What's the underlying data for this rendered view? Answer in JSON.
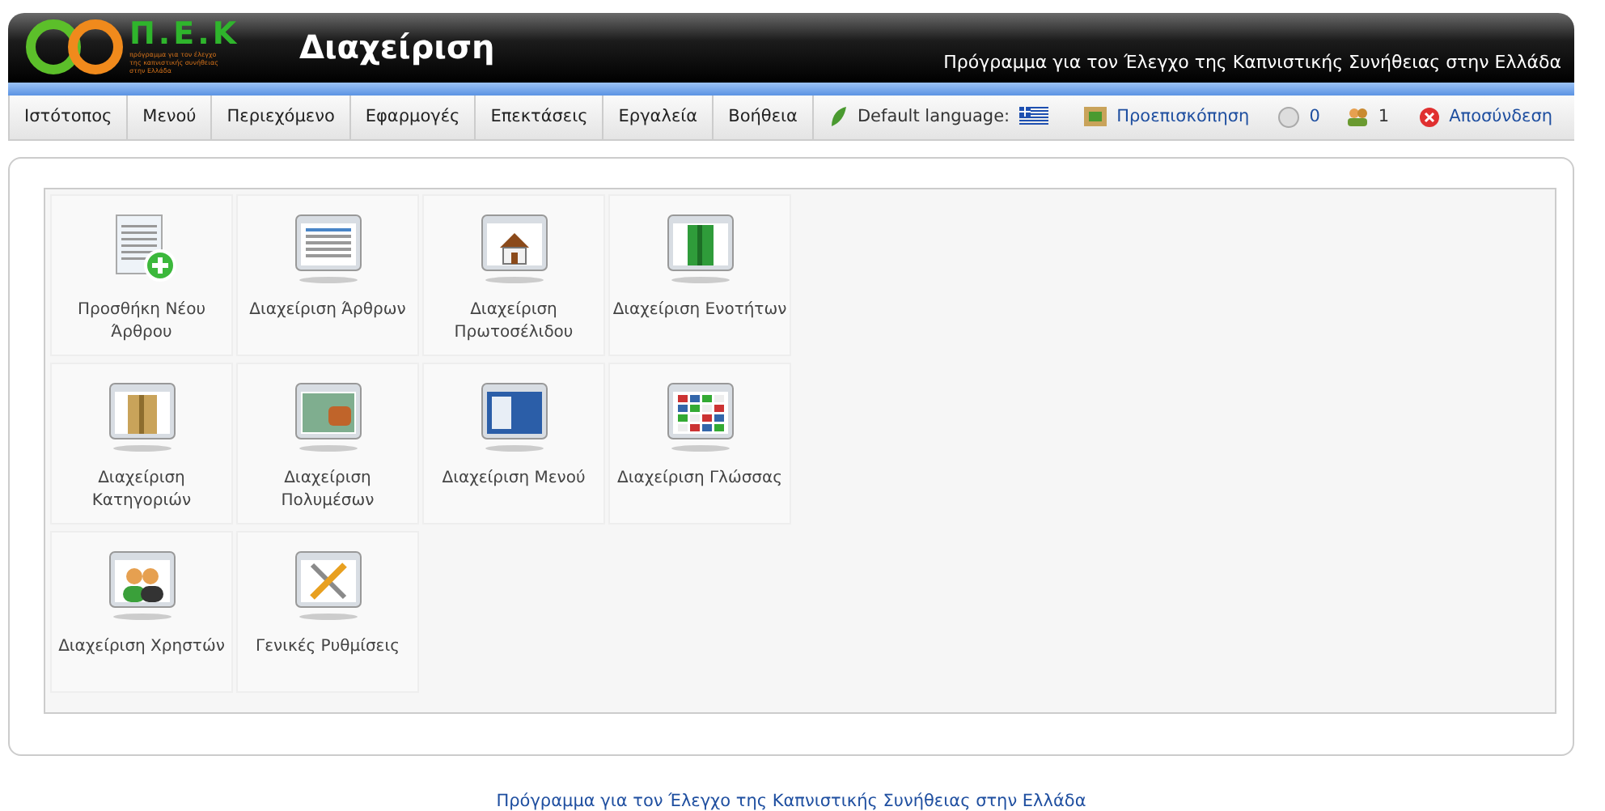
{
  "header": {
    "logo_letters": "Π.Ε.Κ",
    "logo_tagline": "πρόγραμμα για τον έλεγχο της καπνιστικής συνήθειας στην Ελλάδα",
    "title": "Διαχείριση",
    "subtitle": "Πρόγραμμα για τον Έλεγχο της Καπνιστικής Συνήθειας στην Ελλάδα"
  },
  "menu": [
    "Ιστότοπος",
    "Μενού",
    "Περιεχόμενο",
    "Εφαρμογές",
    "Επεκτάσεις",
    "Εργαλεία",
    "Βοήθεια"
  ],
  "status": {
    "language_label": "Default language:",
    "preview": "Προεπισκόπηση",
    "messages": "0",
    "users": "1",
    "logout": "Αποσύνδεση"
  },
  "tiles": [
    {
      "kind": "add-article",
      "label": "Προσθήκη Νέου Άρθρου"
    },
    {
      "kind": "articles",
      "label": "Διαχείριση Άρθρων"
    },
    {
      "kind": "home",
      "label": "Διαχείριση Πρωτοσέλιδου"
    },
    {
      "kind": "section",
      "label": "Διαχείριση Ενοτήτων"
    },
    {
      "kind": "category",
      "label": "Διαχείριση Κατηγοριών"
    },
    {
      "kind": "media",
      "label": "Διαχείριση Πολυμέσων"
    },
    {
      "kind": "menu",
      "label": "Διαχείριση Μενού"
    },
    {
      "kind": "language",
      "label": "Διαχείριση Γλώσσας"
    },
    {
      "kind": "users",
      "label": "Διαχείριση Χρηστών"
    },
    {
      "kind": "config",
      "label": "Γενικές Ρυθμίσεις"
    }
  ],
  "footer": "Πρόγραμμα για τον Έλεγχο της Καπνιστικής Συνήθειας στην Ελλάδα"
}
